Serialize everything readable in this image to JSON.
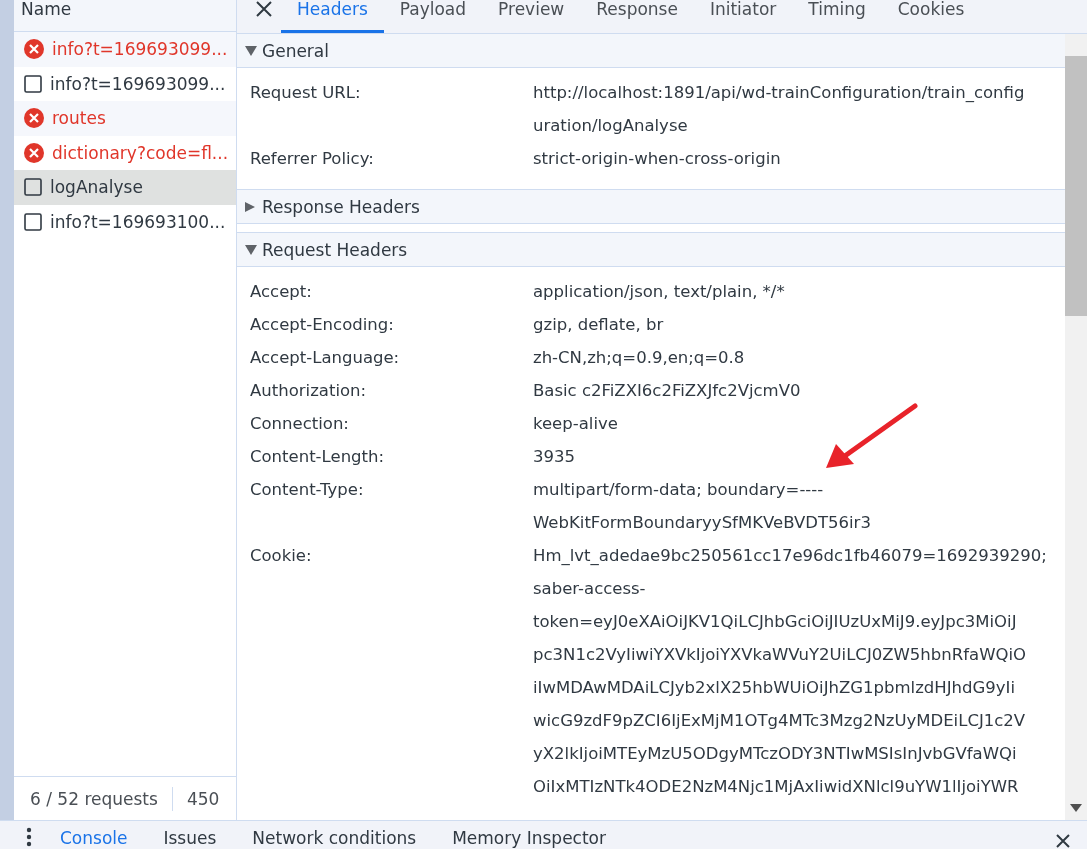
{
  "requests": {
    "header": "Name",
    "items": [
      {
        "name": "info?t=169693099...",
        "kind": "error",
        "selected": false
      },
      {
        "name": "info?t=169693099...",
        "kind": "document",
        "selected": false
      },
      {
        "name": "routes",
        "kind": "error",
        "selected": false
      },
      {
        "name": "dictionary?code=fl...",
        "kind": "error",
        "selected": false
      },
      {
        "name": "logAnalyse",
        "kind": "document",
        "selected": true
      },
      {
        "name": "info?t=169693100...",
        "kind": "document",
        "selected": false
      }
    ]
  },
  "status_bar": {
    "requests": "6 / 52 requests",
    "transferred": "450"
  },
  "tabs": [
    {
      "label": "Headers",
      "selected": true
    },
    {
      "label": "Payload",
      "selected": false
    },
    {
      "label": "Preview",
      "selected": false
    },
    {
      "label": "Response",
      "selected": false
    },
    {
      "label": "Initiator",
      "selected": false
    },
    {
      "label": "Timing",
      "selected": false
    },
    {
      "label": "Cookies",
      "selected": false
    }
  ],
  "sections": [
    {
      "title": "General",
      "expanded": true,
      "rows": [
        {
          "name": "Request URL:",
          "lines": [
            "http://localhost:1891/api/wd-trainConfiguration/train_config",
            "uration/logAnalyse"
          ]
        },
        {
          "name": "Referrer Policy:",
          "lines": [
            "strict-origin-when-cross-origin"
          ]
        }
      ]
    },
    {
      "title": "Response Headers",
      "expanded": false
    },
    {
      "title": "Request Headers",
      "expanded": true,
      "rows": [
        {
          "name": "Accept:",
          "lines": [
            "application/json, text/plain, */*"
          ]
        },
        {
          "name": "Accept-Encoding:",
          "lines": [
            "gzip, deflate, br"
          ]
        },
        {
          "name": "Accept-Language:",
          "lines": [
            "zh-CN,zh;q=0.9,en;q=0.8"
          ]
        },
        {
          "name": "Authorization:",
          "lines": [
            "Basic c2FiZXI6c2FiZXJfc2VjcmV0"
          ]
        },
        {
          "name": "Connection:",
          "lines": [
            "keep-alive"
          ]
        },
        {
          "name": "Content-Length:",
          "lines": [
            "3935"
          ]
        },
        {
          "name": "Content-Type:",
          "lines": [
            "multipart/form-data; boundary=----",
            "WebKitFormBoundaryySfMKVeBVDT56ir3"
          ],
          "annotated": true
        },
        {
          "name": "Cookie:",
          "lines": [
            "Hm_lvt_adedae9bc250561cc17e96dc1fb46079=1692939290;",
            "saber-access-",
            "token=eyJ0eXAiOiJKV1QiLCJhbGciOiJIUzUxMiJ9.eyJpc3MiOiJ",
            "pc3N1c2VyIiwiYXVkIjoiYXVkaWVuY2UiLCJ0ZW5hbnRfaWQiO",
            "iIwMDAwMDAiLCJyb2xlX25hbWUiOiJhZG1pbmlzdHJhdG9yIi",
            "wicG9zdF9pZCI6IjExMjM1OTg4MTc3Mzg2NzUyMDEiLCJ1c2V",
            "yX2lkIjoiMTEyMzU5ODgyMTczODY3NTIwMSIsInJvbGVfaWQi",
            "OiIxMTIzNTk4ODE2NzM4Njc1MjAxIiwidXNlcl9uYW1lIjoiYWR"
          ]
        }
      ]
    }
  ],
  "drawer_tabs": [
    {
      "label": "Console",
      "selected": true
    },
    {
      "label": "Issues",
      "selected": false
    },
    {
      "label": "Network conditions",
      "selected": false
    },
    {
      "label": "Memory Inspector",
      "selected": false
    }
  ]
}
